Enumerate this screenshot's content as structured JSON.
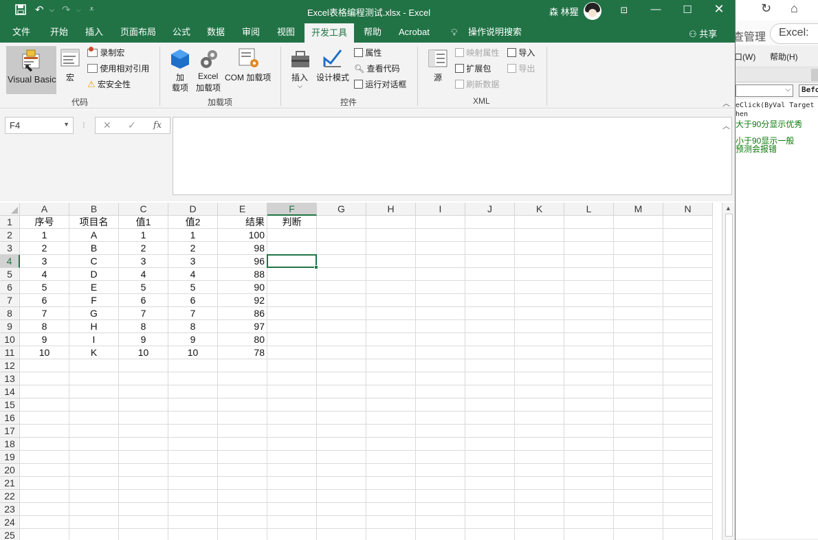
{
  "background_window": {
    "top_icons": [
      "refresh-icon",
      "home-icon"
    ],
    "tab_partial": "查管理",
    "tab_excel": "Excel:",
    "menu_window": "口(W)",
    "menu_help": "帮助(H)",
    "proc_combo": "Befo",
    "code_line1": "eClick(ByVal Target ",
    "code_line2": "hen",
    "comment1": "大于90分显示优秀",
    "comment2": "小于90显示一般",
    "comment3": "预测会报错"
  },
  "titlebar": {
    "doc_title": "Excel表格编程测试.xlsx  -  Excel",
    "user_name": "森 林猩",
    "save_icon": "save-icon",
    "undo_icon": "undo-icon",
    "redo_icon": "redo-icon",
    "customize_icon": "customize-qat-icon"
  },
  "tabs": [
    {
      "label": "文件"
    },
    {
      "label": "开始"
    },
    {
      "label": "插入"
    },
    {
      "label": "页面布局"
    },
    {
      "label": "公式"
    },
    {
      "label": "数据"
    },
    {
      "label": "审阅"
    },
    {
      "label": "视图"
    },
    {
      "label": "开发工具",
      "active": true
    },
    {
      "label": "帮助"
    },
    {
      "label": "Acrobat"
    },
    {
      "label": "操作说明搜索"
    }
  ],
  "share_label": "共享",
  "ribbon": {
    "code": {
      "label": "代码",
      "visual_basic": "Visual Basic",
      "macros": "宏",
      "record_macro": "录制宏",
      "relative_refs": "使用相对引用",
      "macro_security": "宏安全性"
    },
    "addins": {
      "label": "加载项",
      "addins_line1": "加",
      "addins_line2": "载项",
      "excel_addins_line1": "Excel",
      "excel_addins_line2": "加载项",
      "com_addins": "COM 加载项"
    },
    "controls": {
      "label": "控件",
      "insert": "插入",
      "design_mode": "设计模式",
      "properties": "属性",
      "view_code": "查看代码",
      "run_dialog": "运行对话框"
    },
    "xml": {
      "label": "XML",
      "source": "源",
      "map_properties": "映射属性",
      "expansion_packs": "扩展包",
      "refresh_data": "刷新数据",
      "import": "导入",
      "export": "导出"
    }
  },
  "formula_bar": {
    "name_box": "F4",
    "value": ""
  },
  "sheet": {
    "columns": [
      "A",
      "B",
      "C",
      "D",
      "E",
      "F",
      "G",
      "H",
      "I",
      "J",
      "K",
      "L",
      "M",
      "N"
    ],
    "selected_column": "F",
    "selected_row": 4,
    "rows": [
      [
        "序号",
        "项目名",
        "值1",
        "值2",
        "结果",
        "判断"
      ],
      [
        "1",
        "A",
        "1",
        "1",
        "100",
        ""
      ],
      [
        "2",
        "B",
        "2",
        "2",
        "98",
        ""
      ],
      [
        "3",
        "C",
        "3",
        "3",
        "96",
        ""
      ],
      [
        "4",
        "D",
        "4",
        "4",
        "88",
        ""
      ],
      [
        "5",
        "E",
        "5",
        "5",
        "90",
        ""
      ],
      [
        "6",
        "F",
        "6",
        "6",
        "92",
        ""
      ],
      [
        "7",
        "G",
        "7",
        "7",
        "86",
        ""
      ],
      [
        "8",
        "H",
        "8",
        "8",
        "97",
        ""
      ],
      [
        "9",
        "I",
        "9",
        "9",
        "80",
        ""
      ],
      [
        "10",
        "K",
        "10",
        "10",
        "78",
        ""
      ]
    ],
    "row_count": 25
  }
}
